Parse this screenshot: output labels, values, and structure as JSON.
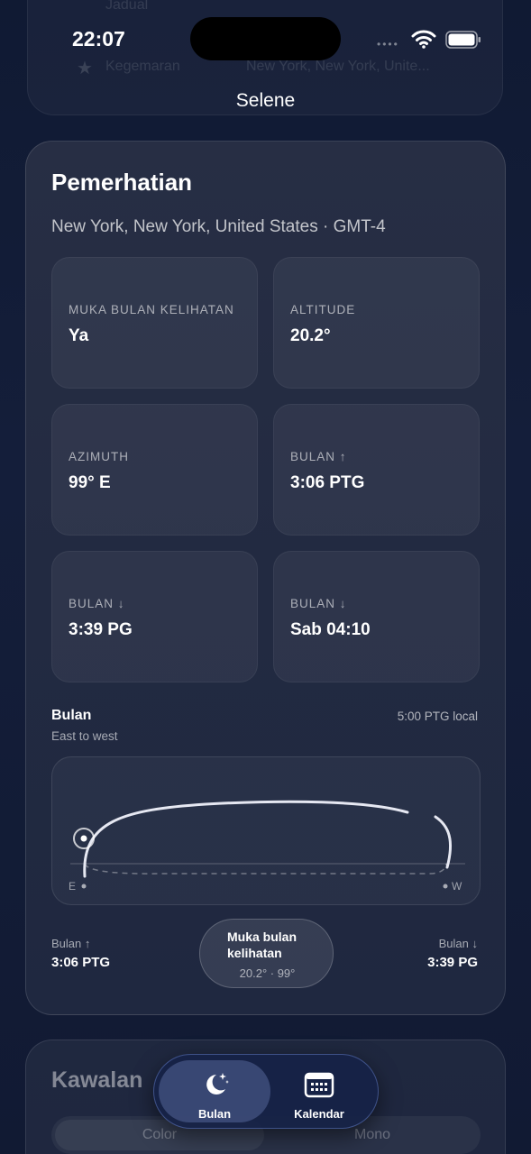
{
  "status_bar": {
    "time": "22:07"
  },
  "app": {
    "title": "Selene"
  },
  "background_card": {
    "line1": "Jadual",
    "favorite_label": "Kegemaran",
    "favorite_value": "New York, New York, Unite..."
  },
  "observation": {
    "title": "Pemerhatian",
    "location": "New York, New York, United States · GMT-4",
    "tiles": [
      {
        "label": "MUKA BULAN KELIHATAN",
        "value": "Ya"
      },
      {
        "label": "ALTITUDE",
        "value": "20.2°"
      },
      {
        "label": "AZIMUTH",
        "value": "99° E"
      },
      {
        "label": "BULAN ↑",
        "value": "3:06 PTG"
      },
      {
        "label": "BULAN ↓",
        "value": "3:39 PG"
      },
      {
        "label": "BULAN ↓",
        "value": "Sab 04:10"
      }
    ]
  },
  "moon_path": {
    "title": "Bulan",
    "subtitle": "East to west",
    "time_label": "5:00 PTG local",
    "east_label": "E",
    "west_label": "W",
    "rise_label": "Bulan ↑",
    "rise_value": "3:06 PTG",
    "set_label": "Bulan ↓",
    "set_value": "3:39 PG",
    "pill_title": "Muka bulan kelihatan",
    "pill_sub": "20.2° · 99°"
  },
  "controls": {
    "title": "Kawalan",
    "option_color": "Color",
    "option_mono": "Mono"
  },
  "tabs": [
    {
      "label": "Bulan",
      "active": true
    },
    {
      "label": "Kalendar",
      "active": false
    }
  ],
  "colors": {
    "accent": "#7f9ae0",
    "card": "#252d44",
    "background": "#121b35"
  }
}
